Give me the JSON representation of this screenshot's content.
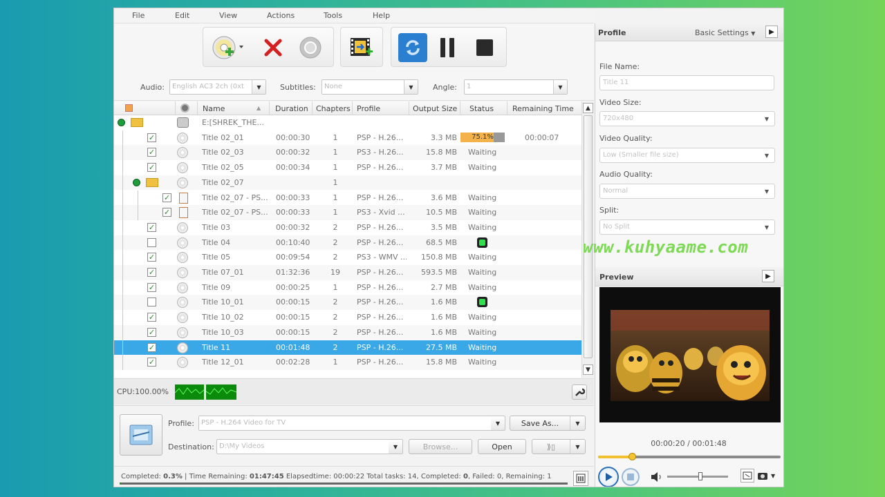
{
  "menu": [
    "File",
    "Edit",
    "View",
    "Actions",
    "Tools",
    "Help"
  ],
  "options": {
    "audio_label": "Audio:",
    "audio_value": "English AC3 2ch (0xt",
    "subtitles_label": "Subtitles:",
    "subtitles_value": "None",
    "angle_label": "Angle:",
    "angle_value": "1"
  },
  "table": {
    "columns": [
      "Name",
      "Duration",
      "Chapters",
      "Profile",
      "Output Size",
      "Status",
      "Remaining Time"
    ],
    "root": "E:[SHREK_THE...",
    "rows": [
      {
        "name": "Title 02_01",
        "duration": "00:00:30",
        "chapters": "1",
        "profile": "PSP - H.26...",
        "size": "3.3 MB",
        "status": "75.1%",
        "progress": 75.1,
        "remaining": "00:00:07",
        "checked": true,
        "level": 1
      },
      {
        "name": "Title 02_03",
        "duration": "00:00:32",
        "chapters": "1",
        "profile": "PS3 - H.26...",
        "size": "15.8 MB",
        "status": "Waiting",
        "remaining": "",
        "checked": true,
        "level": 1
      },
      {
        "name": "Title 02_05",
        "duration": "00:00:34",
        "chapters": "1",
        "profile": "PSP - H.26...",
        "size": "3.7 MB",
        "status": "Waiting",
        "remaining": "",
        "checked": true,
        "level": 1
      },
      {
        "name": "Title 02_07",
        "duration": "",
        "chapters": "1",
        "profile": "",
        "size": "",
        "status": "",
        "remaining": "",
        "folder": true,
        "level": 1
      },
      {
        "name": "Title 02_07 - PS...",
        "duration": "00:00:33",
        "chapters": "1",
        "profile": "PSP - H.26...",
        "size": "3.6 MB",
        "status": "Waiting",
        "remaining": "",
        "checked": true,
        "level": 2
      },
      {
        "name": "Title 02_07 - PS...",
        "duration": "00:00:33",
        "chapters": "1",
        "profile": "PS3 - Xvid ...",
        "size": "10.5 MB",
        "status": "Waiting",
        "remaining": "",
        "checked": true,
        "level": 2
      },
      {
        "name": "Title 03",
        "duration": "00:00:32",
        "chapters": "2",
        "profile": "PSP - H.26...",
        "size": "3.5 MB",
        "status": "Waiting",
        "remaining": "",
        "checked": true,
        "level": 1
      },
      {
        "name": "Title 04",
        "duration": "00:10:40",
        "chapters": "2",
        "profile": "PSP - H.26...",
        "size": "68.5 MB",
        "status": "",
        "remaining": "",
        "checked": false,
        "green": true,
        "level": 1
      },
      {
        "name": "Title 05",
        "duration": "00:09:54",
        "chapters": "2",
        "profile": "PS3 - WMV ...",
        "size": "150.8 MB",
        "status": "Waiting",
        "remaining": "",
        "checked": true,
        "level": 1
      },
      {
        "name": "Title 07_01",
        "duration": "01:32:36",
        "chapters": "19",
        "profile": "PSP - H.26...",
        "size": "593.5 MB",
        "status": "Waiting",
        "remaining": "",
        "checked": true,
        "level": 1
      },
      {
        "name": "Title 09",
        "duration": "00:00:25",
        "chapters": "1",
        "profile": "PSP - H.26...",
        "size": "2.7 MB",
        "status": "Waiting",
        "remaining": "",
        "checked": true,
        "level": 1
      },
      {
        "name": "Title 10_01",
        "duration": "00:00:15",
        "chapters": "2",
        "profile": "PSP - H.26...",
        "size": "1.6 MB",
        "status": "",
        "remaining": "",
        "checked": false,
        "green": true,
        "level": 1
      },
      {
        "name": "Title 10_02",
        "duration": "00:00:15",
        "chapters": "2",
        "profile": "PSP - H.26...",
        "size": "1.6 MB",
        "status": "Waiting",
        "remaining": "",
        "checked": true,
        "level": 1
      },
      {
        "name": "Title 10_03",
        "duration": "00:00:15",
        "chapters": "2",
        "profile": "PSP - H.26...",
        "size": "1.6 MB",
        "status": "Waiting",
        "remaining": "",
        "checked": true,
        "level": 1
      },
      {
        "name": "Title 11",
        "duration": "00:01:48",
        "chapters": "2",
        "profile": "PSP - H.26...",
        "size": "27.5 MB",
        "status": "Waiting",
        "remaining": "",
        "checked": true,
        "selected": true,
        "level": 1
      },
      {
        "name": "Title 12_01",
        "duration": "00:02:28",
        "chapters": "1",
        "profile": "PSP - H.26...",
        "size": "15.8 MB",
        "status": "Waiting",
        "remaining": "",
        "checked": true,
        "level": 1
      }
    ]
  },
  "cpu": {
    "label": "CPU:100.00%",
    "meter1": "CPU",
    "meter2": "CPU"
  },
  "bottom": {
    "profile_label": "Profile:",
    "profile_value": "PSP - H.264 Video for TV",
    "save_as": "Save As...",
    "destination_label": "Destination:",
    "destination_value": "D:\\My Videos",
    "browse": "Browse...",
    "open": "Open"
  },
  "status": {
    "completed_label": "Completed:",
    "completed_value": "0.3%",
    "time_remaining_label": "Time Remaining:",
    "time_remaining_value": "01:47:45",
    "elapsed_label": "Elapsedtime:",
    "elapsed_value": "00:00:22",
    "total_label": "Total tasks:",
    "total_value": "14",
    "completed_tasks_label": "Completed:",
    "completed_tasks_value": "0",
    "failed_label": "Failed:",
    "failed_value": "0",
    "remaining_label": "Remaining:",
    "remaining_value": "1"
  },
  "right": {
    "profile_title": "Profile",
    "basic_settings": "Basic Settings",
    "file_name_label": "File Name:",
    "file_name_value": "Title 11",
    "video_size_label": "Video Size:",
    "video_size_value": "720x480",
    "video_quality_label": "Video Quality:",
    "video_quality_value": "Low (Smaller file size)",
    "audio_quality_label": "Audio Quality:",
    "audio_quality_value": "Normal",
    "split_label": "Split:",
    "split_value": "No Split",
    "preview_title": "Preview",
    "time": "00:00:20 / 00:01:48",
    "seek_fraction": 0.185,
    "volume_fraction": 0.55
  },
  "watermark": "www.kuhyaame.com"
}
